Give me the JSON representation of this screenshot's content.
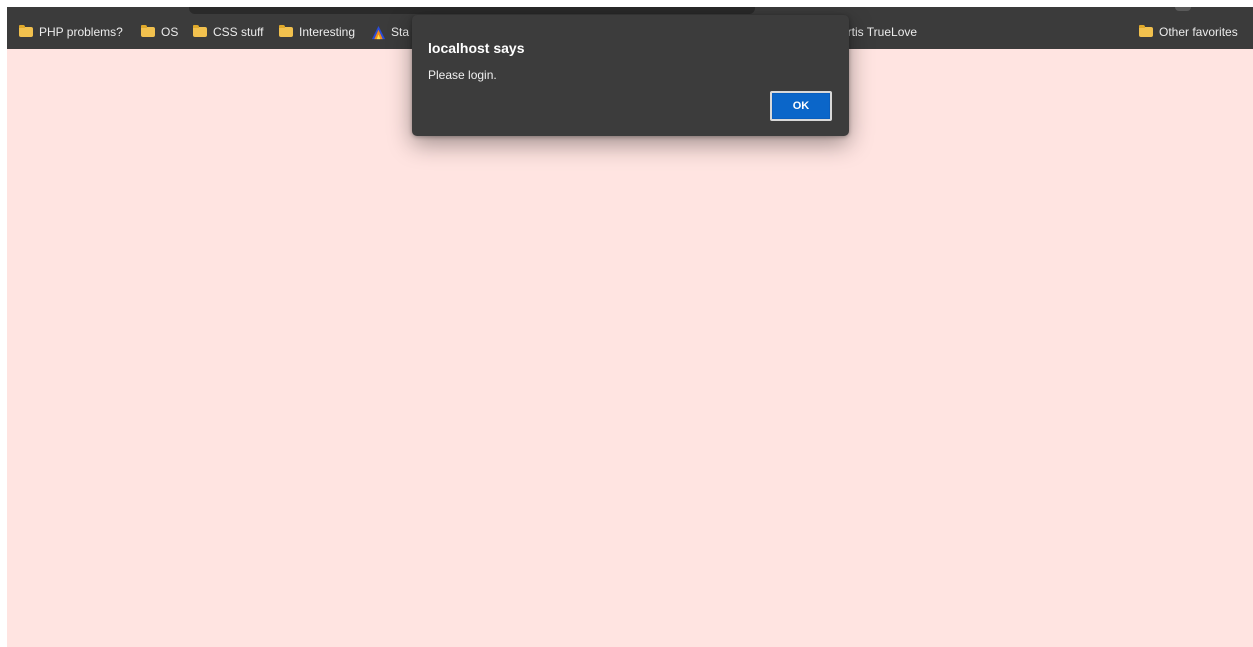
{
  "bookmarks": {
    "items": [
      {
        "label": "PHP problems?",
        "icon": "folder-icon"
      },
      {
        "label": "OS",
        "icon": "folder-icon"
      },
      {
        "label": "CSS stuff",
        "icon": "folder-icon"
      },
      {
        "label": "Interesting",
        "icon": "folder-icon"
      },
      {
        "label": "Sta",
        "icon": "arch-favicon-icon"
      },
      {
        "label": "Kurtis TrueLove",
        "icon": "none"
      }
    ],
    "other_favorites": {
      "label": "Other favorites",
      "icon": "folder-icon"
    }
  },
  "dialog": {
    "title": "localhost says",
    "message": "Please login.",
    "ok_label": "OK"
  },
  "colors": {
    "page_background": "#ffe4e1",
    "bookmarks_bar": "#3b3b3b",
    "dialog_background": "#3c3c3c",
    "ok_button": "#0b66c9",
    "folder": "#f2c14e"
  }
}
